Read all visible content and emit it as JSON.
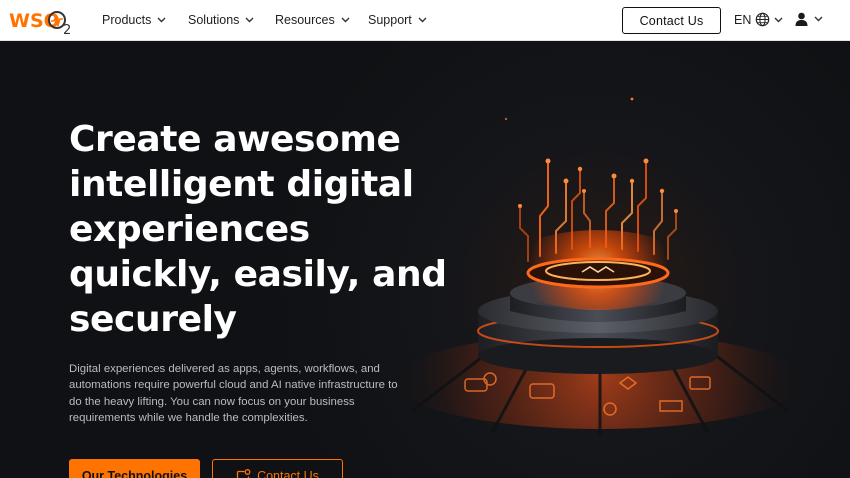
{
  "brand": {
    "logo_text": "WSO",
    "logo_sub": "2",
    "accent": "#ff7300"
  },
  "nav": {
    "items": [
      {
        "label": "Products",
        "icon": "chevron-down-icon"
      },
      {
        "label": "Solutions",
        "icon": "chevron-down-icon"
      },
      {
        "label": "Resources",
        "icon": "chevron-down-icon"
      },
      {
        "label": "Support",
        "icon": "chevron-down-icon"
      }
    ],
    "contact_label": "Contact Us",
    "language": {
      "code": "EN",
      "icon": "globe-icon"
    },
    "user_icon": "user-icon"
  },
  "hero": {
    "headline": "Create awesome intelligent digital experiences quickly, easily, and securely",
    "subtext": "Digital experiences delivered as apps, agents, workflows, and automations require powerful cloud and AI native infrastructure to do the heavy lifting. You can now focus on your business requirements while we handle the complexities.",
    "primary_cta": "Our Technologies",
    "secondary_cta": "Contact Us",
    "secondary_cta_icon": "chat-icon",
    "art": "glowing-platform-illustration"
  }
}
